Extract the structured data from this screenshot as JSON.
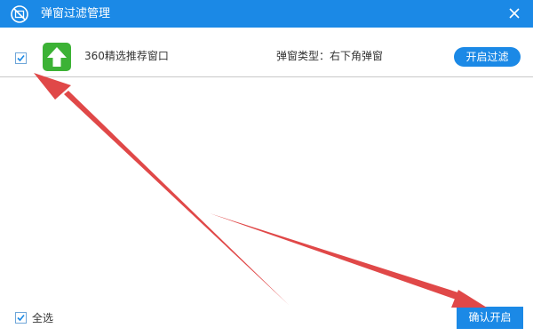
{
  "window": {
    "title": "弹窗过滤管理",
    "icon": "no-popup-icon",
    "close_icon": "close-icon",
    "accent_color": "#1b89e6"
  },
  "list": {
    "items": [
      {
        "checked": true,
        "icon": "upload-arrow-icon",
        "icon_color": "#3cb235",
        "name": "360精选推荐窗口",
        "type_label": "弹窗类型：右下角弹窗",
        "action_label": "开启过滤"
      }
    ]
  },
  "footer": {
    "select_all_checked": true,
    "select_all_label": "全选",
    "confirm_label": "确认开启"
  },
  "annotations": {
    "arrow_color": "#e04848"
  }
}
